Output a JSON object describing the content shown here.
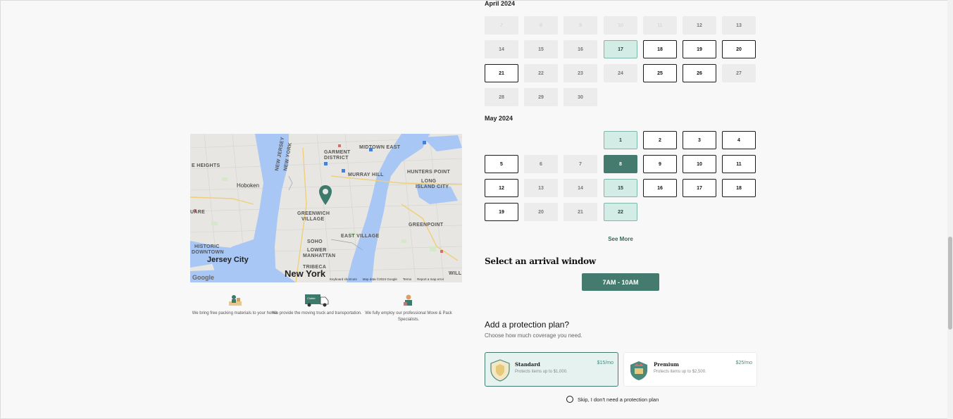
{
  "calendar": {
    "months": [
      {
        "title": "April 2024",
        "days": [
          {
            "label": "7",
            "state": "disabled"
          },
          {
            "label": "8",
            "state": "disabled"
          },
          {
            "label": "9",
            "state": "disabled"
          },
          {
            "label": "10",
            "state": "disabled"
          },
          {
            "label": "11",
            "state": "disabled"
          },
          {
            "label": "12",
            "state": "unavail"
          },
          {
            "label": "13",
            "state": "unavail"
          },
          {
            "label": "14",
            "state": "unavail"
          },
          {
            "label": "15",
            "state": "unavail"
          },
          {
            "label": "16",
            "state": "unavail"
          },
          {
            "label": "17",
            "state": "hl"
          },
          {
            "label": "18",
            "state": "available"
          },
          {
            "label": "19",
            "state": "available"
          },
          {
            "label": "20",
            "state": "available"
          },
          {
            "label": "21",
            "state": "available"
          },
          {
            "label": "22",
            "state": "unavail"
          },
          {
            "label": "23",
            "state": "unavail"
          },
          {
            "label": "24",
            "state": "unavail"
          },
          {
            "label": "25",
            "state": "available"
          },
          {
            "label": "26",
            "state": "available"
          },
          {
            "label": "27",
            "state": "unavail"
          },
          {
            "label": "28",
            "state": "unavail"
          },
          {
            "label": "29",
            "state": "unavail"
          },
          {
            "label": "30",
            "state": "unavail"
          }
        ]
      },
      {
        "title": "May 2024",
        "days": [
          {
            "label": "1",
            "state": "hl"
          },
          {
            "label": "2",
            "state": "available"
          },
          {
            "label": "3",
            "state": "available"
          },
          {
            "label": "4",
            "state": "available"
          },
          {
            "label": "5",
            "state": "available"
          },
          {
            "label": "6",
            "state": "unavail"
          },
          {
            "label": "7",
            "state": "unavail"
          },
          {
            "label": "8",
            "state": "selected"
          },
          {
            "label": "9",
            "state": "available"
          },
          {
            "label": "10",
            "state": "available"
          },
          {
            "label": "11",
            "state": "available"
          },
          {
            "label": "12",
            "state": "available"
          },
          {
            "label": "13",
            "state": "unavail"
          },
          {
            "label": "14",
            "state": "unavail"
          },
          {
            "label": "15",
            "state": "hl"
          },
          {
            "label": "16",
            "state": "available"
          },
          {
            "label": "17",
            "state": "available"
          },
          {
            "label": "18",
            "state": "available"
          },
          {
            "label": "19",
            "state": "available"
          },
          {
            "label": "20",
            "state": "unavail"
          },
          {
            "label": "21",
            "state": "unavail"
          },
          {
            "label": "22",
            "state": "hl"
          }
        ]
      }
    ],
    "see_more": "See More"
  },
  "arrival": {
    "title": "Select an arrival window",
    "window": "7AM - 10AM"
  },
  "protection": {
    "title": "Add a protection plan?",
    "subtitle": "Choose how much coverage you need.",
    "plans": [
      {
        "name": "Standard",
        "desc": "Protects items up to $1,000.",
        "price": "$15/mo"
      },
      {
        "name": "Premium",
        "desc": "Protects items up to $2,500.",
        "price": "$25/mo"
      }
    ],
    "skip": "Skip, I don't need a protection plan"
  },
  "map": {
    "labels": {
      "garment": "GARMENT",
      "district": "DISTRICT",
      "midtown": "MIDTOWN EAST",
      "heights": "E HEIGHTS",
      "murray": "MURRAY HILL",
      "hunters": "HUNTERS POINT",
      "hoboken": "Hoboken",
      "nj": "NEW JERSEY",
      "ny": "NEW YORK",
      "lic1": "LONG",
      "lic2": "ISLAND CITY",
      "greenwich": "GREENWICH",
      "village": "VILLAGE",
      "greenpoint": "GREENPOINT",
      "square": "UARE",
      "east_village": "EAST VILLAGE",
      "soho": "SOHO",
      "historic": "HISTORIC",
      "downtown": "DOWNTOWN",
      "lower": "LOWER",
      "manhattan": "MANHATTAN",
      "jersey_city": "Jersey City",
      "tribeca": "TRIBECA",
      "new_york": "New York",
      "will": "WILL"
    },
    "google": "Google",
    "footer": [
      "Keyboard shortcuts",
      "Map data ©2024 Google",
      "Terms",
      "Report a map error"
    ],
    "colors": {
      "water": "#a8c7f5",
      "land": "#e7e6e2",
      "pin": "#3d7a6c"
    }
  },
  "features": [
    {
      "icon": "packing-materials-icon",
      "text": "We bring free packing materials to your home."
    },
    {
      "icon": "moving-truck-icon",
      "text": "We provide the moving truck and transportation.",
      "badge": "Clutter"
    },
    {
      "icon": "specialist-icon",
      "text": "We fully employ our professional Move & Pack Specialists."
    }
  ]
}
